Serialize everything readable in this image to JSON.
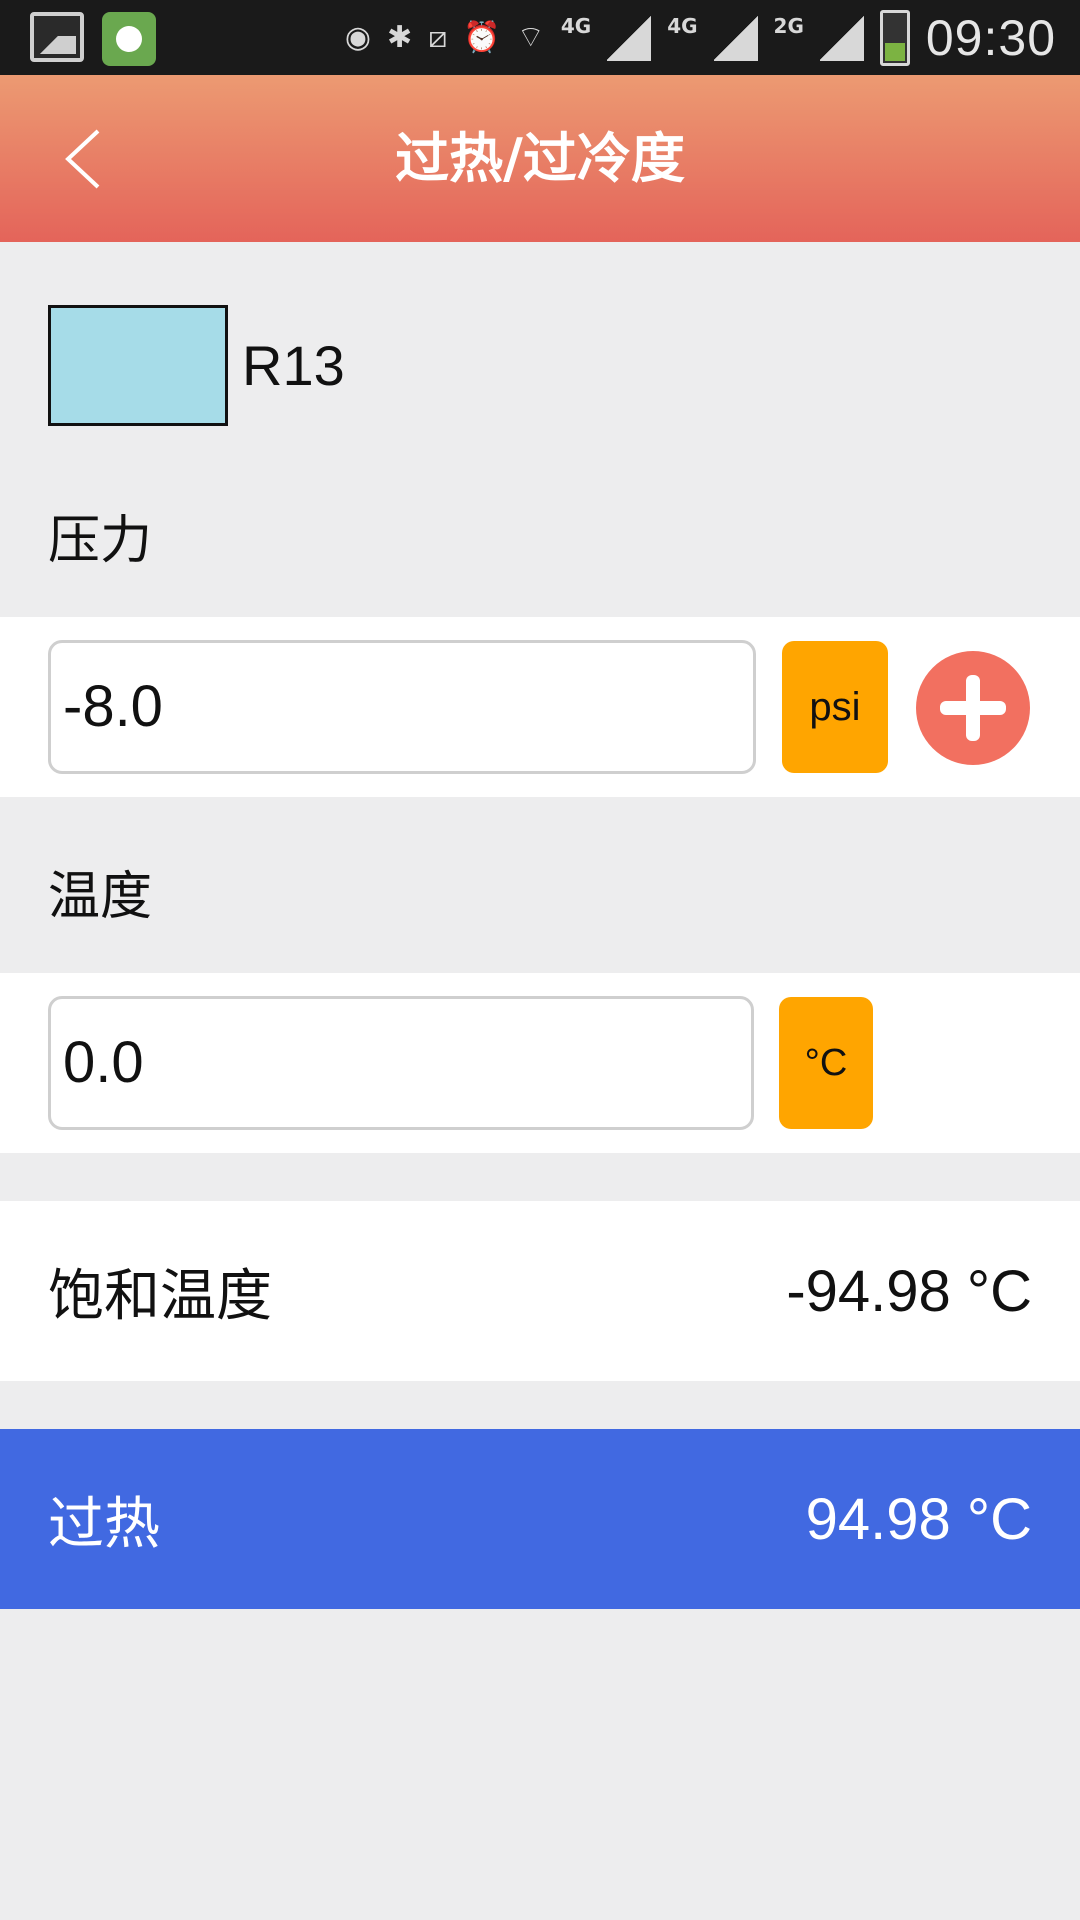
{
  "status_bar": {
    "time": "09:30",
    "network_labels": [
      "4G",
      "4G",
      "2G"
    ],
    "icons": [
      "gallery-icon",
      "app-icon",
      "eye-icon",
      "bluetooth-icon",
      "no-signal-icon",
      "alarm-icon",
      "wifi-icon",
      "signal-icon",
      "battery-icon"
    ]
  },
  "header": {
    "title": "过热/过冷度",
    "back_icon": "back-arrow-icon"
  },
  "refrigerant": {
    "name": "R13",
    "color": "#a6dce8"
  },
  "pressure": {
    "label": "压力",
    "value": "-8.0",
    "unit": "psi",
    "add_icon": "plus-icon"
  },
  "temperature": {
    "label": "温度",
    "value": "0.0",
    "unit": "°C"
  },
  "saturation": {
    "label": "饱和温度",
    "value": "-94.98 °C"
  },
  "superheat": {
    "label": "过热",
    "value": "94.98 °C",
    "color": "#4169e1"
  }
}
